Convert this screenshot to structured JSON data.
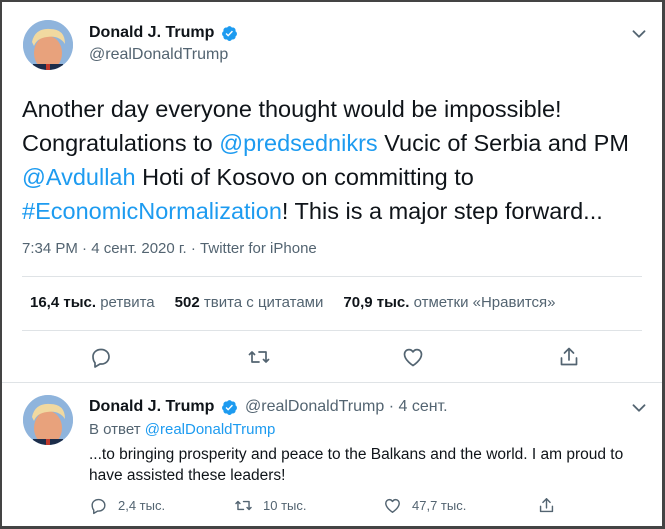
{
  "main_tweet": {
    "author_name": "Donald J. Trump",
    "author_handle": "@realDonaldTrump",
    "text_parts": {
      "p1": "Another day everyone thought would be impossible! Congratulations to ",
      "mention1": "@predsednikrs",
      "p2": " Vucic of Serbia and PM ",
      "mention2": "@Avdullah",
      "p3": " Hoti of Kosovo on committing to ",
      "hashtag": "#EconomicNormalization",
      "p4": "! This is a major step forward..."
    },
    "timestamp": "7:34 PM · 4 сент. 2020 г. · ",
    "source": "Twitter for iPhone",
    "stats": {
      "retweets_count": "16,4 тыс.",
      "retweets_label": "ретвита",
      "quotes_count": "502",
      "quotes_label": "твита с цитатами",
      "likes_count": "70,9 тыс.",
      "likes_label": "отметки «Нравится»"
    }
  },
  "reply_tweet": {
    "author_name": "Donald J. Trump",
    "author_handle_time": "@realDonaldTrump · 4 сент.",
    "reply_to_prefix": "В ответ ",
    "reply_to_handle": "@realDonaldTrump",
    "text": "...to bringing prosperity and peace to the Balkans and the world. I am proud to have assisted these leaders!",
    "reply_count": "2,4 тыс.",
    "retweet_count": "10 тыс.",
    "like_count": "47,7 тыс."
  },
  "icons": {
    "verified": "verified-badge-icon",
    "caret": "chevron-down-icon",
    "reply": "reply-icon",
    "retweet": "retweet-icon",
    "like": "heart-icon",
    "share": "share-icon"
  },
  "colors": {
    "link": "#1d9bf0",
    "secondary_text": "#536471",
    "primary_text": "#0f1419"
  }
}
